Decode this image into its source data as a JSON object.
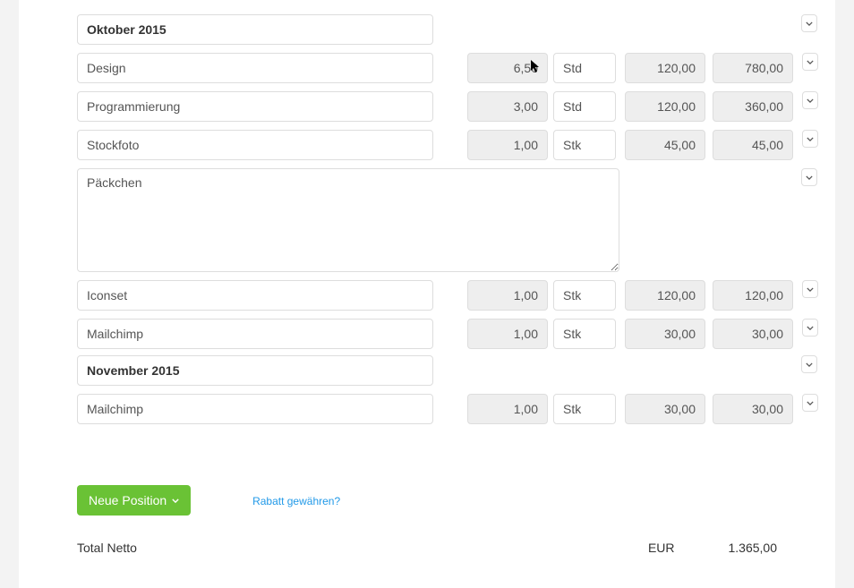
{
  "groups": {
    "oct": {
      "title": "Oktober 2015"
    },
    "nov": {
      "title": "November 2015"
    }
  },
  "lines": {
    "design": {
      "desc": "Design",
      "qty": "6,50",
      "unit": "Std",
      "price": "120,00",
      "total": "780,00"
    },
    "prog": {
      "desc": "Programmierung",
      "qty": "3,00",
      "unit": "Std",
      "price": "120,00",
      "total": "360,00"
    },
    "stockfoto": {
      "desc": "Stockfoto",
      "qty": "1,00",
      "unit": "Stk",
      "price": "45,00",
      "total": "45,00"
    },
    "paeckchen": {
      "desc": "Päckchen"
    },
    "iconset": {
      "desc": "Iconset",
      "qty": "1,00",
      "unit": "Stk",
      "price": "120,00",
      "total": "120,00"
    },
    "mc1": {
      "desc": "Mailchimp",
      "qty": "1,00",
      "unit": "Stk",
      "price": "30,00",
      "total": "30,00"
    },
    "mc2": {
      "desc": "Mailchimp",
      "qty": "1,00",
      "unit": "Stk",
      "price": "30,00",
      "total": "30,00"
    }
  },
  "buttons": {
    "newPosition": "Neue Position"
  },
  "links": {
    "discount": "Rabatt gewähren?"
  },
  "totals": {
    "labelNet": "Total Netto",
    "currency": "EUR",
    "net": "1.365,00"
  }
}
